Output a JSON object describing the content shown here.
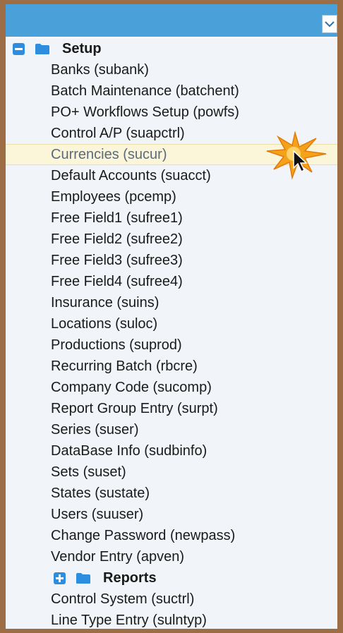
{
  "colors": {
    "frame": "#9d6e45",
    "topbar": "#4aa0d9",
    "panel": "#f1f4f8",
    "highlight": "#fbf5d9",
    "accent": "#2d8ee0",
    "burst": "#f5a21b"
  },
  "topbar": {
    "dropdown_icon": "chevron-down-icon"
  },
  "tree": {
    "setup": {
      "label": "Setup",
      "toggle_icon": "collapse-minus-icon",
      "folder_icon": "folder-icon",
      "items": [
        "Banks (subank)",
        "Batch Maintenance (batchent)",
        "PO+ Workflows Setup (powfs)",
        "Control A/P (suapctrl)",
        "Currencies (sucur)",
        "Default Accounts (suacct)",
        "Employees (pcemp)",
        "Free Field1 (sufree1)",
        "Free Field2 (sufree2)",
        "Free Field3 (sufree3)",
        "Free Field4 (sufree4)",
        "Insurance (suins)",
        "Locations (suloc)",
        "Productions (suprod)",
        "Recurring Batch (rbcre)",
        "Company Code (sucomp)",
        "Report Group Entry (surpt)",
        "Series (suser)",
        "DataBase Info (sudbinfo)",
        "Sets (suset)",
        "States (sustate)",
        "Users (suuser)",
        "Change Password (newpass)",
        "Vendor Entry (apven)"
      ]
    },
    "reports": {
      "label": "Reports",
      "toggle_icon": "expand-plus-icon",
      "folder_icon": "folder-icon"
    },
    "after_reports": [
      "Control System (suctrl)",
      "Line Type Entry (sulntyp)"
    ],
    "highlighted_item": "Currencies (sucur)"
  },
  "cursor": {
    "icon": "mouse-pointer-icon",
    "effect": "click-burst-icon"
  }
}
